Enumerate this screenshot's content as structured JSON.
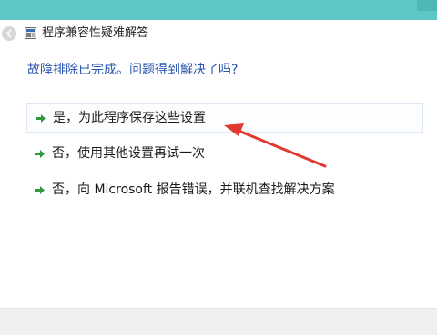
{
  "window": {
    "title": "程序兼容性疑难解答"
  },
  "main": {
    "question": "故障排除已完成。问题得到解决了吗?",
    "options": [
      {
        "label": "是，为此程序保存这些设置",
        "icon": "green-arrow-icon"
      },
      {
        "label": "否，使用其他设置再试一次",
        "icon": "green-arrow-icon"
      },
      {
        "label": "否，向 Microsoft 报告错误，并联机查找解决方案",
        "icon": "green-arrow-icon"
      }
    ]
  },
  "colors": {
    "top_band": "#5dc6c6",
    "question_text": "#2a56b0",
    "arrow_green": "#2e9a3c",
    "annotation_red": "#e03a30"
  }
}
